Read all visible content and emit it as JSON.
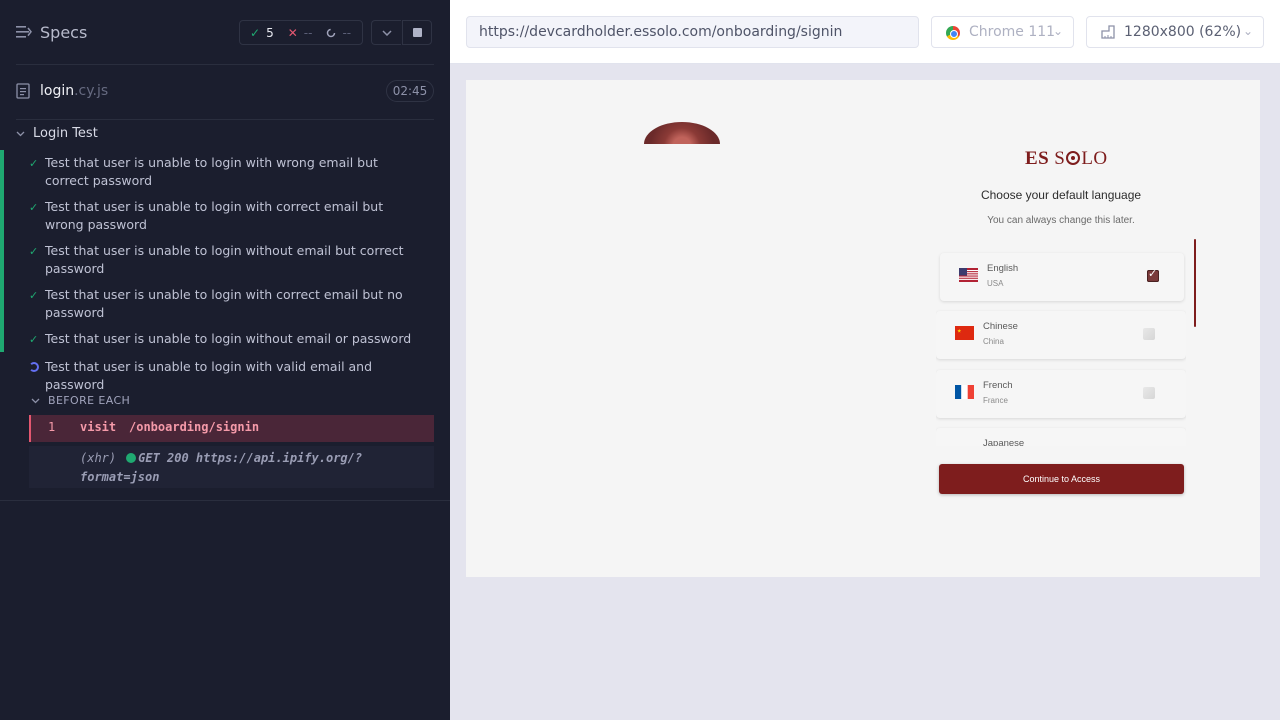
{
  "reporter": {
    "header": {
      "title": "Specs",
      "passed_count": "5",
      "failed_count": "--",
      "pending_count": "--"
    },
    "file": {
      "name": "login",
      "ext": ".cy.js",
      "duration": "02:45"
    },
    "suite": {
      "title": "Login Test",
      "tests": [
        {
          "title": "Test that user is unable to login with wrong email but correct password",
          "state": "passed"
        },
        {
          "title": "Test that user is unable to login with correct email but wrong password",
          "state": "passed"
        },
        {
          "title": "Test that user is unable to login without email but correct password",
          "state": "passed"
        },
        {
          "title": "Test that user is unable to login with correct email but no password",
          "state": "passed"
        },
        {
          "title": "Test that user is unable to login without email or password",
          "state": "passed"
        },
        {
          "title": "Test that user is unable to login with valid email and password",
          "state": "running"
        }
      ]
    },
    "hook": {
      "label": "BEFORE EACH",
      "command": {
        "number": "1",
        "name": "visit",
        "arg": "/onboarding/signin"
      },
      "xhr": {
        "prefix": "(xhr)",
        "request": "GET 200 https://api.ipify.org/?",
        "request_cont": "format=json"
      }
    }
  },
  "aut_bar": {
    "url": "https://devcardholder.essolo.com/onboarding/signin",
    "browser": "Chrome 111",
    "viewport": "1280x800",
    "scale": "(62%)"
  },
  "app": {
    "logo_left": "ES",
    "logo_mid": "S",
    "logo_right": "LO",
    "title": "Choose your default language",
    "subtitle": "You can always change this later.",
    "languages": [
      {
        "name": "English",
        "region": "USA",
        "flag": "us-flag-icon",
        "selected": true
      },
      {
        "name": "Chinese",
        "region": "China",
        "flag": "cn-flag-icon",
        "selected": false
      },
      {
        "name": "French",
        "region": "France",
        "flag": "fr-flag-icon",
        "selected": false
      },
      {
        "name": "Japanese",
        "region": "",
        "flag": "jp-flag-icon",
        "selected": false
      }
    ],
    "continue_label": "Continue to Access",
    "brand_color": "#7e1d1d"
  },
  "colors": {
    "pass": "#1fa971",
    "fail": "#e45770",
    "running": "#6470f3",
    "reporter_bg": "#1b1e2e"
  }
}
